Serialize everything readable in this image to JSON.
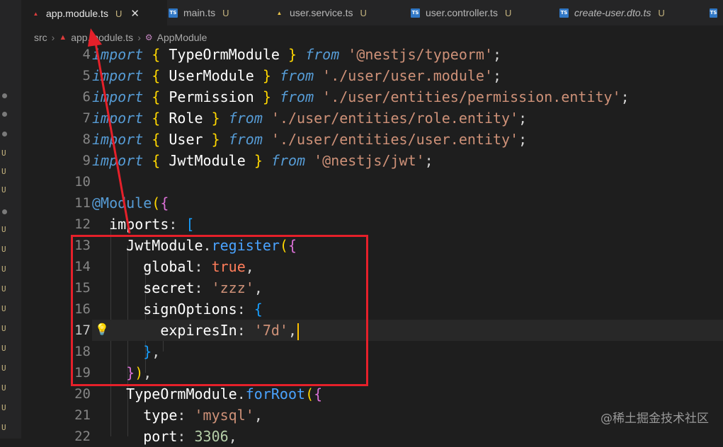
{
  "tabs": [
    {
      "label": "app.module.ts",
      "icon": "angular-icon",
      "status": "U",
      "active": true
    },
    {
      "label": "main.ts",
      "icon": "ts-icon",
      "status": "U",
      "active": false
    },
    {
      "label": "user.service.ts",
      "icon": "js-icon",
      "status": "U",
      "active": false
    },
    {
      "label": "user.controller.ts",
      "icon": "ts-icon",
      "status": "U",
      "active": false
    },
    {
      "label": "create-user.dto.ts",
      "icon": "ts-icon",
      "status": "U",
      "active": false
    }
  ],
  "breadcrumb": {
    "root": "src",
    "file": "app.module.ts",
    "symbol": "AppModule"
  },
  "code_lines": [
    {
      "n": "4",
      "text": "import { TypeOrmModule } from '@nestjs/typeorm';"
    },
    {
      "n": "5",
      "text": "import { UserModule } from './user/user.module';"
    },
    {
      "n": "6",
      "text": "import { Permission } from './user/entities/permission.entity';"
    },
    {
      "n": "7",
      "text": "import { Role } from './user/entities/role.entity';"
    },
    {
      "n": "8",
      "text": "import { User } from './user/entities/user.entity';"
    },
    {
      "n": "9",
      "text": "import { JwtModule } from '@nestjs/jwt';"
    },
    {
      "n": "10",
      "text": ""
    },
    {
      "n": "11",
      "text": "@Module({"
    },
    {
      "n": "12",
      "text": "  imports: ["
    },
    {
      "n": "13",
      "text": "    JwtModule.register({"
    },
    {
      "n": "14",
      "text": "      global: true,"
    },
    {
      "n": "15",
      "text": "      secret: 'zzz',"
    },
    {
      "n": "16",
      "text": "      signOptions: {"
    },
    {
      "n": "17",
      "text": "        expiresIn: '7d',"
    },
    {
      "n": "18",
      "text": "      },"
    },
    {
      "n": "19",
      "text": "    }),"
    },
    {
      "n": "20",
      "text": "    TypeOrmModule.forRoot({"
    },
    {
      "n": "21",
      "text": "      type: 'mysql',"
    },
    {
      "n": "22",
      "text": "      port: 3306,"
    }
  ],
  "current_line": "17",
  "watermark": "@稀土掘金技术社区",
  "colors": {
    "highlight_box": "#e5202a",
    "editor_bg": "#1e1e1e",
    "keyword": "#569cd6",
    "string": "#ce9178"
  }
}
